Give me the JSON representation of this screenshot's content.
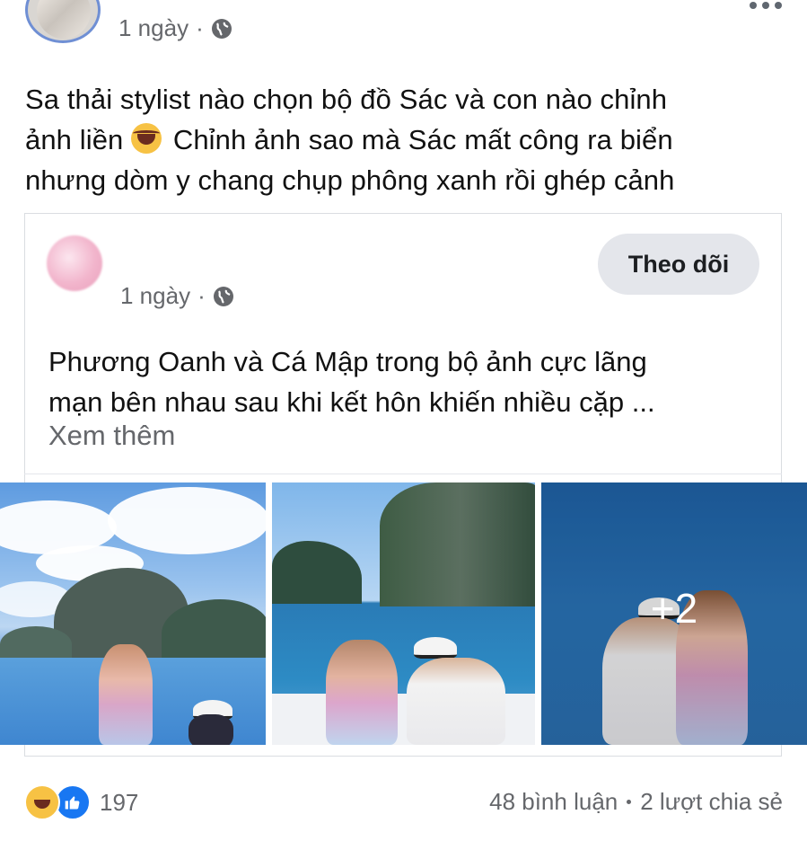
{
  "post": {
    "author_name": "",
    "time": "1 ngày",
    "privacy_icon": "globe-icon",
    "menu_icon": "more-horizontal-icon",
    "caption_line1": "Sa thải stylist nào chọn bộ đồ Sác và con nào chỉnh",
    "caption_line2a": "ảnh liền",
    "caption_emoji": "laughing-crying-emoji",
    "caption_line2b": "Chỉnh ảnh sao mà Sác mất công ra biển",
    "caption_line3": "nhưng dòm y chang chụp phông xanh rồi ghép cảnh"
  },
  "shared": {
    "author_name": "",
    "time": "1 ngày",
    "privacy_icon": "globe-icon",
    "follow_label": "Theo dõi",
    "text_line1": "Phương Oanh và Cá Mập trong bộ ảnh cực lãng",
    "text_line2": "mạn bên nhau sau khi kết hôn khiến nhiều cặp ...",
    "see_more": "Xem thêm",
    "extra_photos": "+2"
  },
  "footer": {
    "reaction_icons": [
      "haha-reaction-icon",
      "like-reaction-icon"
    ],
    "reaction_count": "197",
    "comments": "48 bình luận",
    "shares": "2 lượt chia sẻ"
  },
  "colors": {
    "accent": "#1877f2",
    "secondary_text": "#65676b",
    "button_bg": "#e4e6eb"
  }
}
